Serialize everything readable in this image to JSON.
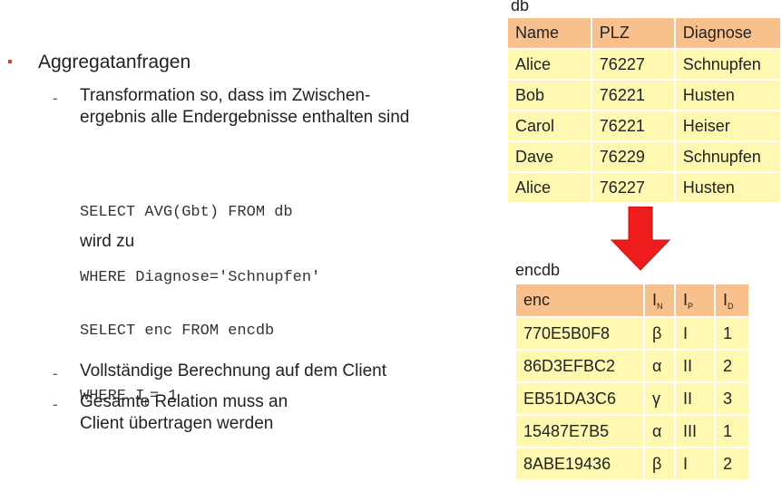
{
  "slide": {
    "bullet": "Aggregatanfragen",
    "dash1_line1": "Transformation so, dass im Zwischen-",
    "dash1_line2": "ergebnis alle Endergebnisse enthalten sind",
    "code1_line1": "SELECT AVG(Gbt) FROM db",
    "code1_line2": "WHERE Diagnose='Schnupfen'",
    "wird_zu": "wird zu",
    "code2_line1": "SELECT enc FROM encdb",
    "code2_line2a": "WHERE I",
    "code2_line2_sub": "D",
    "code2_line2b": "= 1",
    "dash2": "Vollständige Berechnung auf dem Client",
    "dash3_line1": "Gesamte Relation muss an",
    "dash3_line2": "Client übertragen werden",
    "dash_char": "-"
  },
  "db_table": {
    "title": "db",
    "headers": [
      "Name",
      "PLZ",
      "Diagnose"
    ],
    "rows": [
      [
        "Alice",
        "76227",
        "Schnupfen"
      ],
      [
        "Bob",
        "76221",
        "Husten"
      ],
      [
        "Carol",
        "76221",
        "Heiser"
      ],
      [
        "Dave",
        "76229",
        "Schnupfen"
      ],
      [
        "Alice",
        "76227",
        "Husten"
      ]
    ]
  },
  "encdb_table": {
    "title": "encdb",
    "headers": [
      {
        "main": "enc",
        "sub": ""
      },
      {
        "main": "I",
        "sub": "N"
      },
      {
        "main": "I",
        "sub": "P"
      },
      {
        "main": "I",
        "sub": "D"
      }
    ],
    "rows": [
      [
        "770E5B0F8",
        "β",
        "I",
        "1"
      ],
      [
        "86D3EFBC2",
        "α",
        "II",
        "2"
      ],
      [
        "EB51DA3C6",
        "γ",
        "II",
        "3"
      ],
      [
        "15487E7B5",
        "α",
        "III",
        "1"
      ],
      [
        "8ABE19436",
        "β",
        "I",
        "2"
      ]
    ]
  },
  "colors": {
    "header": "#f8c08c",
    "row": "#fef8b0",
    "arrow": "#ee1c1c",
    "bullet": "#e04020"
  },
  "icons": {
    "arrow": "red-down-arrow-icon"
  }
}
